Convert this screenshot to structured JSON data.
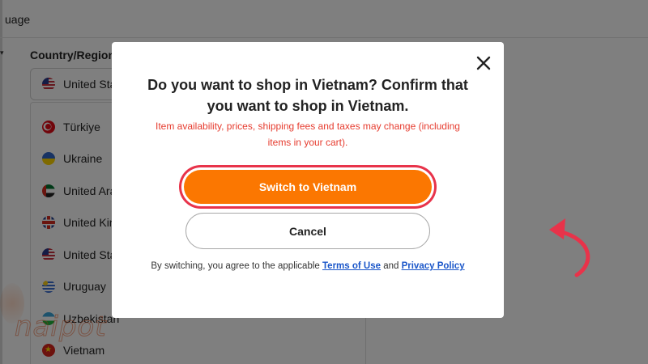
{
  "background": {
    "language_label_partial": "uage",
    "country_label": "Country/Region",
    "selected_country": "United Sta",
    "countries": [
      {
        "name": "Türkiye",
        "flag": "flag-turkey-icon"
      },
      {
        "name": "Ukraine",
        "flag": "flag-ukraine-icon"
      },
      {
        "name": "United Ara",
        "flag": "flag-uae-icon"
      },
      {
        "name": "United Kin",
        "flag": "flag-uk-icon"
      },
      {
        "name": "United Sta",
        "flag": "flag-us-icon"
      },
      {
        "name": "Uruguay",
        "flag": "flag-uruguay-icon"
      },
      {
        "name": "Uzbekistan",
        "flag": "flag-uzbekistan-icon"
      },
      {
        "name": "Vietnam",
        "flag": "flag-vietnam-icon"
      }
    ],
    "watermark": "naipot"
  },
  "modal": {
    "title": "Do you want to shop in Vietnam? Confirm that you want to shop in Vietnam.",
    "warning": "Item availability, prices, shipping fees and taxes may change (including items in your cart).",
    "switch_label": "Switch to Vietnam",
    "cancel_label": "Cancel",
    "legal_prefix": "By switching, you agree to the applicable ",
    "terms_link": "Terms of Use",
    "legal_and": " and ",
    "privacy_link": "Privacy Policy"
  },
  "colors": {
    "accent_orange": "#fb7701",
    "warning_red": "#e63b2e",
    "link_blue": "#1a56c9",
    "annotation_red": "#e8334a"
  }
}
